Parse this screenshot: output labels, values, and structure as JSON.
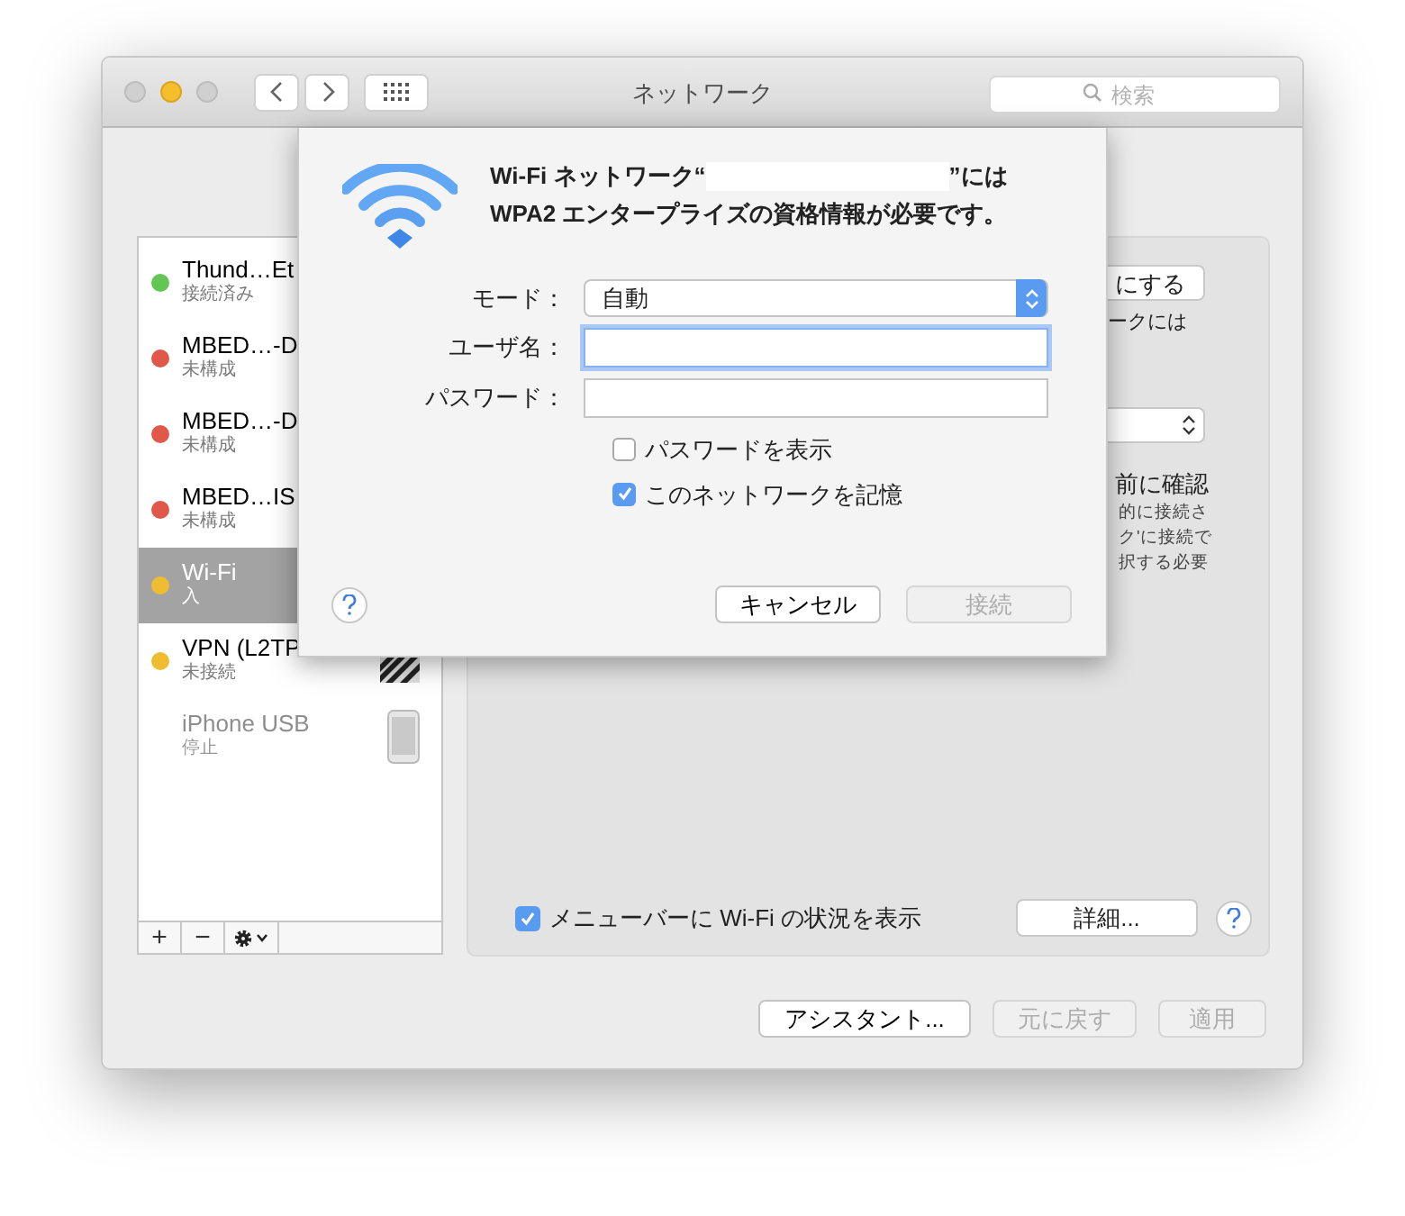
{
  "window": {
    "title": "ネットワーク",
    "search_placeholder": "検索"
  },
  "sidebar": {
    "items": [
      {
        "name": "Thund…Et",
        "status": "接続済み",
        "color": "#62c554",
        "selected": false,
        "disabled": false,
        "kind": "plain"
      },
      {
        "name": "MBED…-D",
        "status": "未構成",
        "color": "#e0584a",
        "selected": false,
        "disabled": false,
        "kind": "plain"
      },
      {
        "name": "MBED…-D",
        "status": "未構成",
        "color": "#e0584a",
        "selected": false,
        "disabled": false,
        "kind": "plain"
      },
      {
        "name": "MBED…IS",
        "status": "未構成",
        "color": "#e0584a",
        "selected": false,
        "disabled": false,
        "kind": "plain"
      },
      {
        "name": "Wi-Fi",
        "status": "入",
        "color": "#f0bd32",
        "selected": true,
        "disabled": false,
        "kind": "plain"
      },
      {
        "name": "VPN (L2TP",
        "status": "未接続",
        "color": "#f0bd32",
        "selected": false,
        "disabled": false,
        "kind": "vpn"
      },
      {
        "name": "iPhone USB",
        "status": "停止",
        "selected": false,
        "disabled": true,
        "kind": "iphone"
      }
    ],
    "toolbar": [
      "+",
      "−"
    ]
  },
  "panel": {
    "button": "にする",
    "text": "ークには",
    "confirm": "前に確認",
    "note_lines": [
      "的に接続さ",
      "ク'に接続で",
      "択する必要"
    ],
    "menu_bar_checkbox": {
      "label": "メニューバーに Wi-Fi の状況を表示",
      "checked": true
    },
    "advanced_button": "詳細..."
  },
  "footer_buttons": [
    {
      "label": "アシスタント...",
      "disabled": false
    },
    {
      "label": "元に戻す",
      "disabled": true
    },
    {
      "label": "適用",
      "disabled": true
    }
  ],
  "sheet": {
    "heading": {
      "before_name": "Wi-Fi ネットワーク“",
      "after_name": "”には",
      "line_2": "WPA2 エンタープライズの資格情報が必要です。"
    },
    "fields": [
      {
        "label": "モード：",
        "kind": "select",
        "value": "自動",
        "focused": false
      },
      {
        "label": "ユーザ名：",
        "kind": "text",
        "focused": true
      },
      {
        "label": "パスワード：",
        "kind": "text",
        "focused": false
      }
    ],
    "checkboxes": [
      {
        "label": "パスワードを表示",
        "checked": false
      },
      {
        "label": "このネットワークを記憶",
        "checked": true
      }
    ],
    "buttons": [
      {
        "label": "キャンセル",
        "disabled": false
      },
      {
        "label": "接続",
        "disabled": true
      }
    ]
  }
}
